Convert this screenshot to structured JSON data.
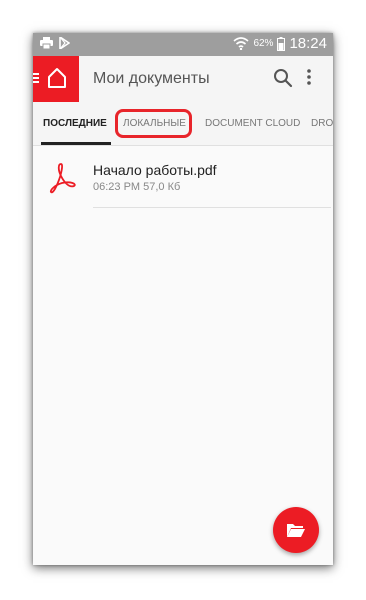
{
  "statusbar": {
    "battery_pct": "62%",
    "time": "18:24",
    "icons": [
      "printer-icon",
      "play-store-icon",
      "wifi-icon",
      "battery-icon"
    ]
  },
  "appbar": {
    "title": "Мои документы",
    "home_icon": "home-icon",
    "search_icon": "search-icon",
    "more_icon": "more-vert-icon"
  },
  "tabs": [
    {
      "label": "ПОСЛЕДНИЕ",
      "active": true
    },
    {
      "label": "ЛОКАЛЬНЫЕ",
      "active": false,
      "highlighted": true
    },
    {
      "label": "DOCUMENT CLOUD",
      "active": false
    },
    {
      "label": "DROI",
      "active": false
    }
  ],
  "files": [
    {
      "name": "Начало работы.pdf",
      "meta": "06:23 PM  57,0 Кб",
      "icon": "pdf-icon"
    }
  ],
  "fab": {
    "icon": "folder-open-icon"
  },
  "colors": {
    "accent": "#ec1c24",
    "statusbar": "#9e9e9e",
    "highlight": "#e8252b"
  }
}
